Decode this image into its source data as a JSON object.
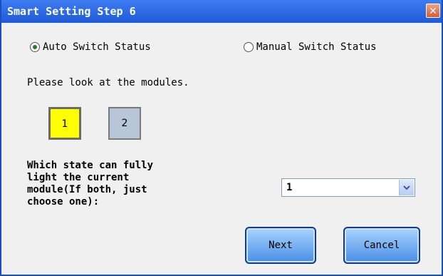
{
  "window": {
    "title": "Smart Setting Step 6"
  },
  "radios": {
    "auto_label": "Auto Switch Status",
    "manual_label": "Manual Switch Status",
    "selected": "auto"
  },
  "instruction": "Please look at the modules.",
  "modules": [
    {
      "label": "1",
      "color": "#ffff00"
    },
    {
      "label": "2",
      "color": "#b8c6d8"
    }
  ],
  "question": {
    "line1": "Which state can fully",
    "line2": "light the current",
    "line3": "module(If both, just",
    "line4": "choose one):"
  },
  "state_select": {
    "value": "1"
  },
  "buttons": {
    "next": "Next",
    "cancel": "Cancel"
  },
  "colors": {
    "titlebar": "#2563dc",
    "button": "#6aa8ef"
  }
}
